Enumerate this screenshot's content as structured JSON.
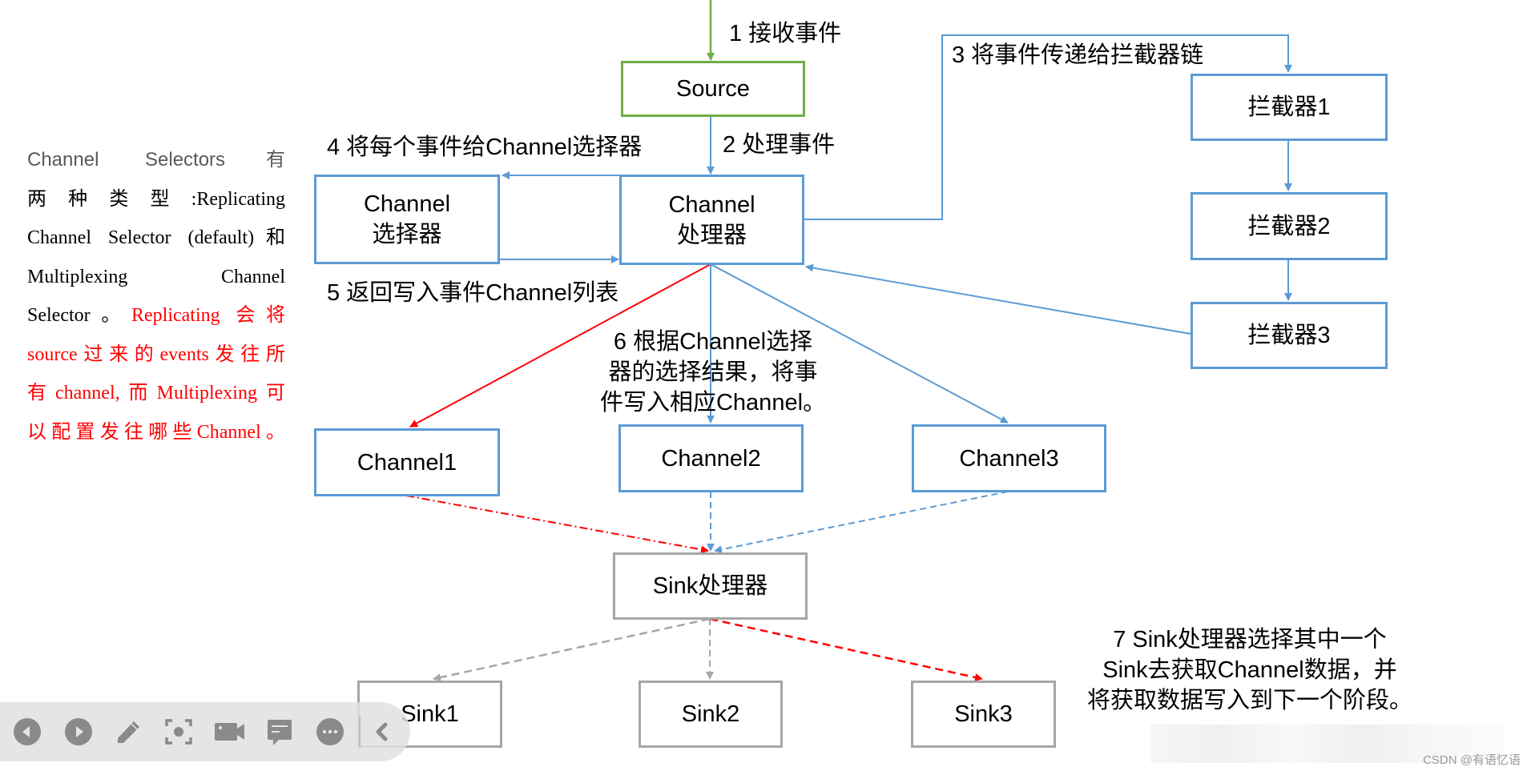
{
  "colors": {
    "blue": "#5b9bd5",
    "green": "#70ad47",
    "red": "#ff0000",
    "gray": "#a6a6a6",
    "text": "#000000",
    "note_gray": "#595959"
  },
  "side_note": {
    "lines": [
      {
        "parts": [
          {
            "text": "Channel Selectors有",
            "style": "gray-sans"
          }
        ]
      },
      {
        "parts": [
          {
            "text": "两种类型:Replicating",
            "style": "black"
          }
        ]
      },
      {
        "parts": [
          {
            "text": "Channel Selector (default)和",
            "style": "black"
          }
        ]
      },
      {
        "parts": [
          {
            "text": "Multiplexing Channel",
            "style": "black"
          }
        ]
      },
      {
        "parts": [
          {
            "text": "Selector。",
            "style": "black"
          },
          {
            "text": "Replicating 会将",
            "style": "red"
          }
        ]
      },
      {
        "parts": [
          {
            "text": "source过来的events发往所",
            "style": "red"
          }
        ]
      },
      {
        "parts": [
          {
            "text": "有channel,而Multiplexing可",
            "style": "red"
          }
        ]
      },
      {
        "parts": [
          {
            "text": "以配置发往哪些Channel。",
            "style": "red"
          }
        ]
      }
    ]
  },
  "nodes": {
    "source": "Source",
    "channel_selector": [
      "Channel",
      "选择器"
    ],
    "channel_processor": [
      "Channel",
      "处理器"
    ],
    "interceptor1": "拦截器1",
    "interceptor2": "拦截器2",
    "interceptor3": "拦截器3",
    "channel1": "Channel1",
    "channel2": "Channel2",
    "channel3": "Channel3",
    "sink_processor": "Sink处理器",
    "sink1": "Sink1",
    "sink2": "Sink2",
    "sink3": "Sink3"
  },
  "steps": {
    "step1": "1 接收事件",
    "step2": "2 处理事件",
    "step3": "3 将事件传递给拦截器链",
    "step4": "4 将每个事件给Channel选择器",
    "step5": "5 返回写入事件Channel列表",
    "step6": [
      "6 根据Channel选择",
      "器的选择结果，将事",
      "件写入相应Channel。"
    ],
    "step7": [
      "7 Sink处理器选择其中一个",
      "Sink去获取Channel数据，并",
      "将获取数据写入到下一个阶段。"
    ]
  },
  "toolbar": {
    "buttons": [
      {
        "name": "previous-button",
        "icon": "previous-icon"
      },
      {
        "name": "next-button",
        "icon": "next-icon"
      },
      {
        "name": "pen-button",
        "icon": "pen-icon"
      },
      {
        "name": "screenshot-button",
        "icon": "focus-capture-icon"
      },
      {
        "name": "video-button",
        "icon": "video-camera-icon"
      },
      {
        "name": "comment-button",
        "icon": "comment-icon"
      },
      {
        "name": "more-button",
        "icon": "more-icon"
      },
      {
        "name": "collapse-toolbar-button",
        "icon": "chevron-left-icon"
      }
    ]
  },
  "watermark": "CSDN @有语忆语"
}
